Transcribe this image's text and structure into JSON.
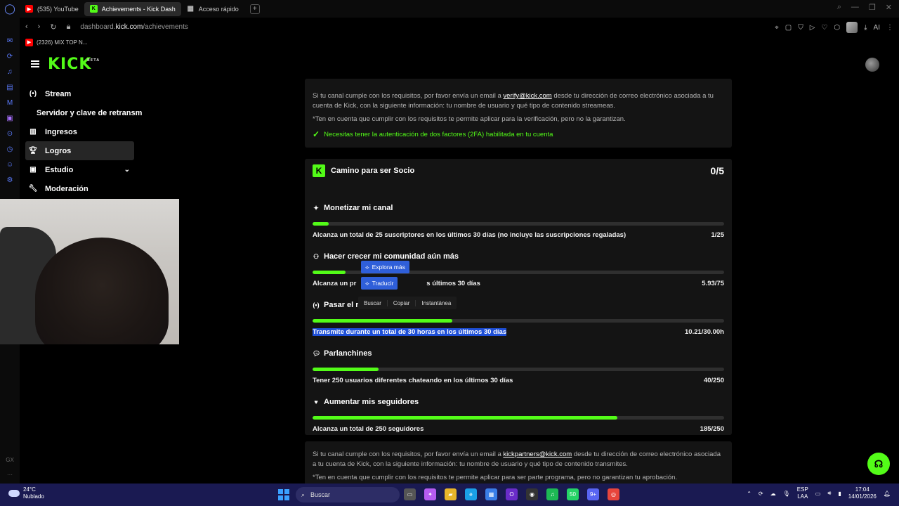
{
  "browser": {
    "tabs": [
      {
        "label": "(535) YouTube",
        "icon": "youtube-icon"
      },
      {
        "label": "Achievements - Kick Dash",
        "icon": "kick-icon"
      },
      {
        "label": "Acceso rápido",
        "icon": "grid-icon"
      }
    ],
    "url_prefix": "dashboard.",
    "url_domain": "kick.com",
    "url_path": "/achievements",
    "bookmark": "(2326) MIX TOP N...",
    "ai_label": "AI"
  },
  "sidebar": {
    "items": [
      {
        "label": "Stream",
        "icon": "broadcast-icon"
      },
      {
        "label": "Servidor y clave de retransm",
        "icon": ""
      },
      {
        "label": "Ingresos",
        "icon": "chart-icon"
      },
      {
        "label": "Logros",
        "icon": "trophy-icon"
      },
      {
        "label": "Estudio",
        "icon": "studio-icon"
      },
      {
        "label": "Moderación",
        "icon": "wrench-icon"
      }
    ]
  },
  "verification": {
    "text_before": "Si tu canal cumple con los requisitos, por favor envía un email a ",
    "email": "verify@kick.com",
    "text_after": " desde tu dirección de correo electrónico asociada a tu cuenta de Kick, con la siguiente información: tu nombre de usuario y qué tipo de contenido streameas.",
    "note": "*Ten en cuenta que cumplir con los requisitos te permite aplicar para la verificación, pero no la garantizan.",
    "requirement": "Necesitas tener la autenticación de dos factores (2FA) habilitada en tu cuenta"
  },
  "partner": {
    "title": "Camino para ser Socio",
    "count": "0/5",
    "achievements": [
      {
        "title": "Monetizar mi canal",
        "desc": "Alcanza un total de 25 suscriptores en los últimos 30 días (no incluye las suscripciones regaladas)",
        "value": "1/25",
        "progress": 0.04
      },
      {
        "title": "Hacer crecer mi comunidad aún más",
        "desc_a": "Alcanza un pr",
        "desc_b": "s últimos 30 días",
        "value": "5.93/75",
        "progress": 0.08
      },
      {
        "title": "Pasar el r",
        "desc_a": "Transmite durante",
        "desc_b": "un total de 30 horas en los últimos 30 días",
        "value": "10.21/30.00h",
        "progress": 0.34
      },
      {
        "title": "Parlanchines",
        "desc": "Tener 250 usuarios diferentes chateando en los últimos 30 días",
        "value": "40/250",
        "progress": 0.16
      },
      {
        "title": "Aumentar mis seguidores",
        "desc": "Alcanza un total de 250 seguidores",
        "value": "185/250",
        "progress": 0.74
      }
    ],
    "footer_before": "Si tu canal cumple con los requisitos, por favor envía un email a ",
    "footer_email": "kickpartners@kick.com",
    "footer_after": " desde tu dirección de correo electrónico asociada a tu cuenta de Kick, con la siguiente información: tu nombre de usuario y qué tipo de contenido transmites.",
    "footer_note": "*Ten en cuenta que cumplir con los requisitos te permite aplicar para ser parte programa, pero no garantizan tu aprobación."
  },
  "context_menu": {
    "explore": "Explora más",
    "translate": "Traducir",
    "search": "Buscar",
    "copy": "Copiar",
    "snapshot": "Instantánea"
  },
  "taskbar": {
    "temp": "24°C",
    "weather": "Nublado",
    "search": "Buscar",
    "lang1": "ESP",
    "lang2": "LAA",
    "time": "17:04",
    "date": "14/01/2026",
    "badge1": "50",
    "badge2": "9+"
  },
  "colors": {
    "accent": "#53fc18",
    "highlight": "#1e4fd8",
    "card": "#141414",
    "taskbar": "#1a1a52"
  },
  "opera_sidebar_footer": "GX"
}
